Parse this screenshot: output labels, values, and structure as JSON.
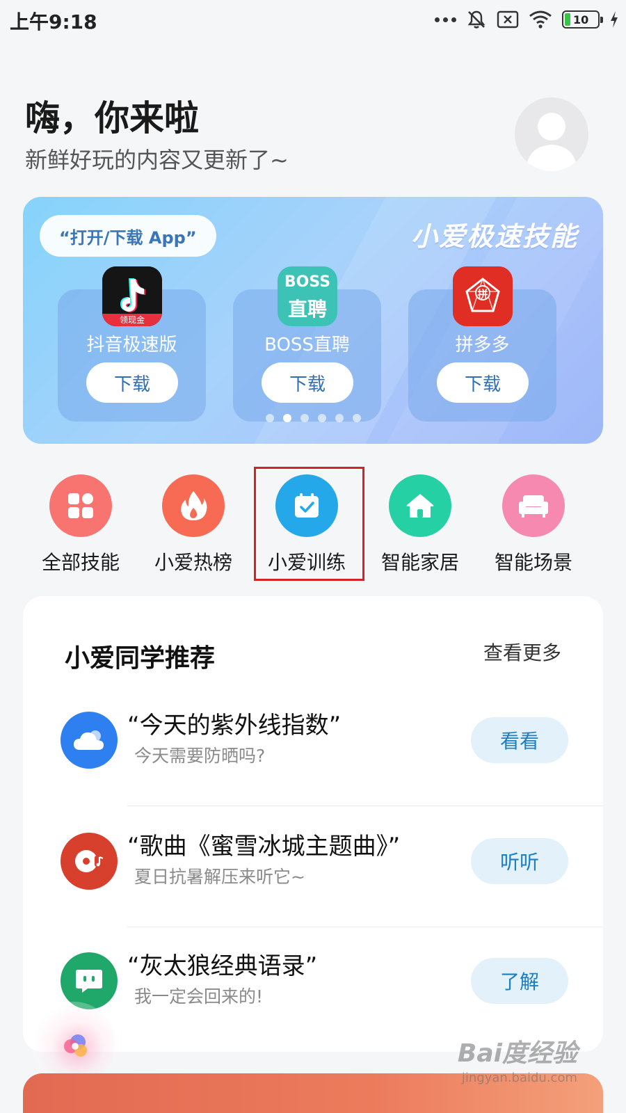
{
  "status_bar": {
    "time": "上午9:18",
    "battery_level": "10",
    "icons": [
      "more-dots-icon",
      "mute-icon",
      "no-sim-icon",
      "wifi-icon",
      "battery-icon",
      "charging-icon"
    ]
  },
  "header": {
    "greeting": "嗨，你来啦",
    "subtitle": "新鲜好玩的内容又更新了~"
  },
  "banner": {
    "pill_label": "“打开/下载 App”",
    "title": "小爱极速技能",
    "apps": [
      {
        "name": "抖音极速版",
        "button": "下载",
        "icon_badge": "领现金"
      },
      {
        "name": "BOSS直聘",
        "button": "下载",
        "icon_text_top": "BOSS",
        "icon_text_bottom": "直聘"
      },
      {
        "name": "拼多多",
        "button": "下载",
        "icon_text": "拼"
      }
    ],
    "page_count": 6,
    "active_page": 2
  },
  "categories": [
    {
      "label": "全部技能",
      "color": "#f77470"
    },
    {
      "label": "小爱热榜",
      "color": "#f76b55"
    },
    {
      "label": "小爱训练",
      "color": "#25a8ea",
      "highlighted": true
    },
    {
      "label": "智能家居",
      "color": "#26d0a5"
    },
    {
      "label": "智能场景",
      "color": "#f589b0"
    }
  ],
  "recommend": {
    "title": "小爱同学推荐",
    "more": "查看更多",
    "items": [
      {
        "title": "“今天的紫外线指数”",
        "subtitle": "今天需要防晒吗?",
        "button": "看看",
        "icon": "weather-cloud-icon",
        "color": "#2e7ff0"
      },
      {
        "title": "“歌曲《蜜雪冰城主题曲》”",
        "subtitle": "夏日抗暑解压来听它~",
        "button": "听听",
        "icon": "music-disc-icon",
        "color": "#d6402c"
      },
      {
        "title": "“灰太狼经典语录”",
        "subtitle": "我一定会回来的!",
        "button": "了解",
        "icon": "chat-bubble-icon",
        "color": "#1fa86a"
      }
    ]
  },
  "watermark": {
    "main": "Bai度经验",
    "url": "jingyan.baidu.com"
  }
}
